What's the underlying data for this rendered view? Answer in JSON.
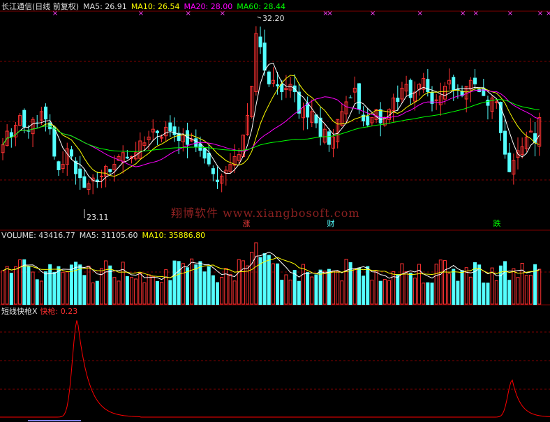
{
  "price_panel": {
    "title": "长江通信(日线 前复权)",
    "ma5": "MA5: 26.91",
    "ma10": "MA10: 26.54",
    "ma20": "MA20: 28.00",
    "ma60": "MA60: 28.44",
    "high_label": "32.20",
    "low_label": "23.11",
    "watermark": "翔博软件 www.xiangbosoft.com",
    "tags": [
      "涨",
      "财",
      "跌"
    ]
  },
  "volume_panel": {
    "title": "VOLUME: 43416.77",
    "ma5": "MA5: 31105.60",
    "ma10": "MA10: 35886.80"
  },
  "indicator_panel": {
    "name": "短线快枪X",
    "value": "快枪: 0.23"
  },
  "colors": {
    "up": "#ff3232",
    "down": "#54ffff",
    "ma5": "#ffffff",
    "ma10": "#ffff00",
    "ma20": "#ff00ff",
    "ma60": "#00ff00",
    "grid": "#800000",
    "indicator": "#ff0000"
  },
  "chart_data": {
    "type": "candlestick",
    "close": [
      25.9,
      26.6,
      26.3,
      26.9,
      27.4,
      26.8,
      26.6,
      27.2,
      27.0,
      27.6,
      27.2,
      26.7,
      25.3,
      24.6,
      24.9,
      25.7,
      25.3,
      24.4,
      24.2,
      23.7,
      23.9,
      24.2,
      24.0,
      24.3,
      24.8,
      24.5,
      24.9,
      25.3,
      25.5,
      25.2,
      25.3,
      25.5,
      26.1,
      26.0,
      26.3,
      26.7,
      26.5,
      26.3,
      26.8,
      26.6,
      26.4,
      26.1,
      26.4,
      25.9,
      26.2,
      25.8,
      25.6,
      25.2,
      24.9,
      24.4,
      24.0,
      24.3,
      24.6,
      24.9,
      25.3,
      25.4,
      26.4,
      27.4,
      28.9,
      31.6,
      30.9,
      29.7,
      29.0,
      29.2,
      28.9,
      28.6,
      28.8,
      29.0,
      28.6,
      27.5,
      27.8,
      27.3,
      27.6,
      27.0,
      26.3,
      26.7,
      25.9,
      26.3,
      27.2,
      27.6,
      28.1,
      28.3,
      28.8,
      27.7,
      27.1,
      26.9,
      27.3,
      27.7,
      27.0,
      27.3,
      27.7,
      28.3,
      28.1,
      28.8,
      29.0,
      28.3,
      28.6,
      29.0,
      29.3,
      28.6,
      28.0,
      28.2,
      28.4,
      28.9,
      29.2,
      28.7,
      28.7,
      28.4,
      28.9,
      29.2,
      29.0,
      28.6,
      28.4,
      27.9,
      28.3,
      28.1,
      26.5,
      25.4,
      24.5,
      25.1,
      25.6,
      25.8,
      26.3,
      26.6,
      26.0,
      27.3
    ],
    "ma5": 26.91,
    "ma10": 26.54,
    "ma20": 28.0,
    "ma60": 28.44,
    "high": 32.2,
    "low": 23.11,
    "volume": 43416.77,
    "volume_ma5": 31105.6,
    "volume_ma10": 35886.8,
    "indicator": 0.23
  }
}
